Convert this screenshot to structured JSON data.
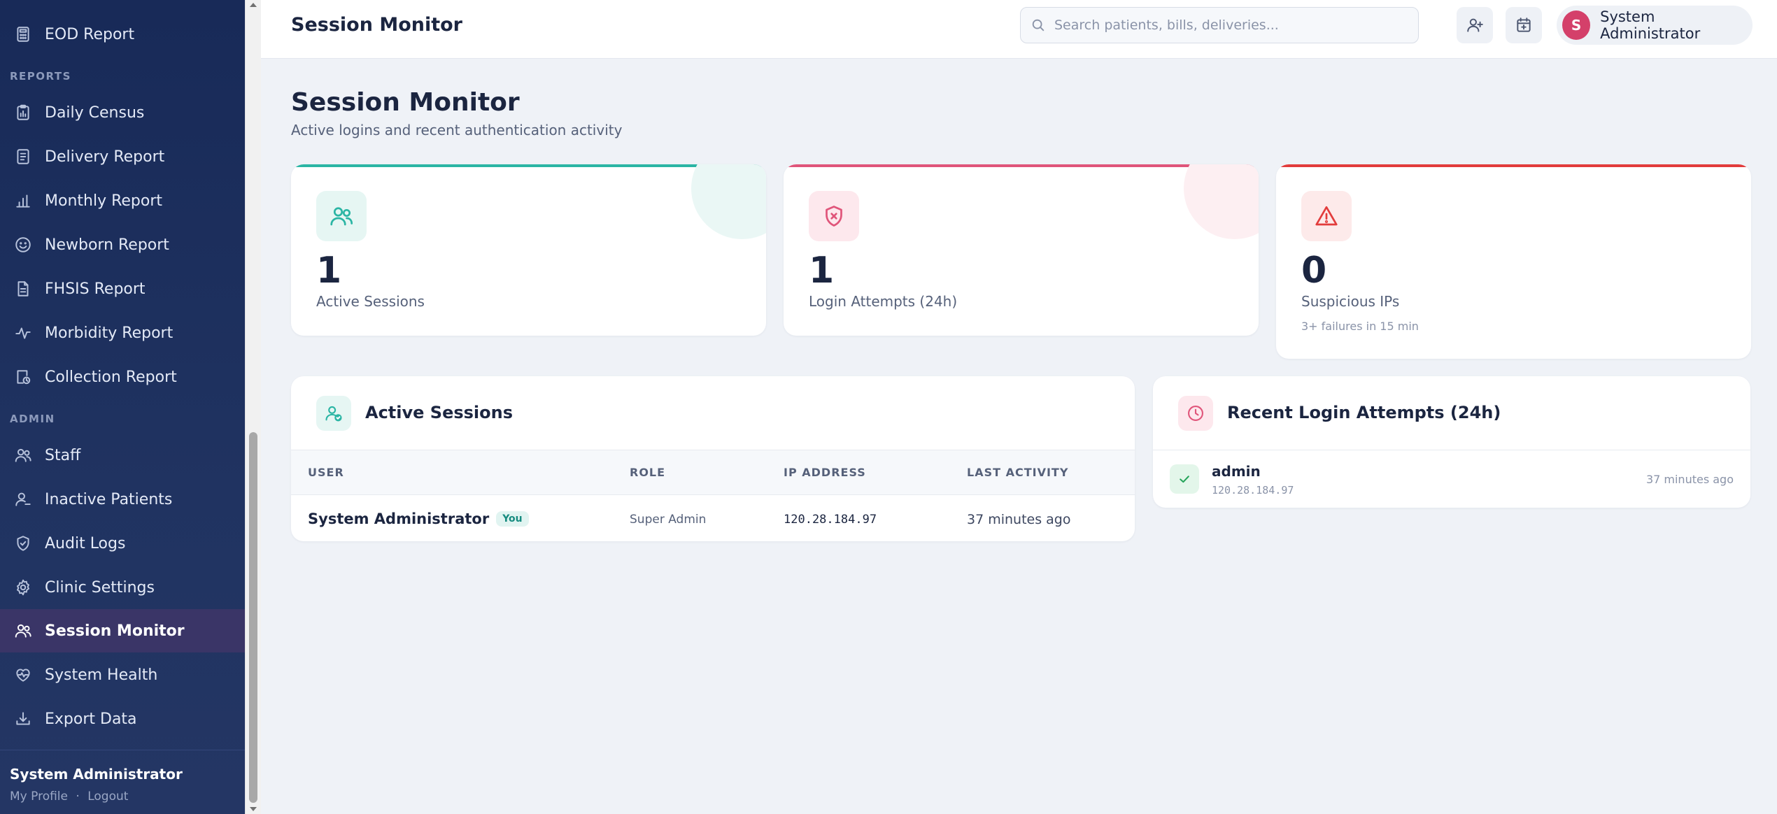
{
  "sidebar": {
    "items_top": [
      {
        "label": "EOD Report",
        "icon": "calculator-icon"
      }
    ],
    "sections": {
      "reports": "REPORTS",
      "admin": "ADMIN"
    },
    "reports": [
      {
        "label": "Daily Census",
        "icon": "clipboard-chart-icon"
      },
      {
        "label": "Delivery Report",
        "icon": "document-icon"
      },
      {
        "label": "Monthly Report",
        "icon": "bar-chart-icon"
      },
      {
        "label": "Newborn Report",
        "icon": "smile-icon"
      },
      {
        "label": "FHSIS Report",
        "icon": "file-text-icon"
      },
      {
        "label": "Morbidity Report",
        "icon": "activity-icon"
      },
      {
        "label": "Collection Report",
        "icon": "receipt-clock-icon"
      }
    ],
    "admin": [
      {
        "label": "Staff",
        "icon": "users-icon"
      },
      {
        "label": "Inactive Patients",
        "icon": "user-minus-icon"
      },
      {
        "label": "Audit Logs",
        "icon": "shield-check-icon"
      },
      {
        "label": "Clinic Settings",
        "icon": "gear-icon"
      },
      {
        "label": "Session Monitor",
        "icon": "users-icon",
        "active": true
      },
      {
        "label": "System Health",
        "icon": "heart-pulse-icon"
      },
      {
        "label": "Export Data",
        "icon": "download-icon"
      }
    ],
    "footer": {
      "name": "System Administrator",
      "profile_link": "My Profile",
      "separator": "·",
      "logout_link": "Logout"
    }
  },
  "header": {
    "title": "Session Monitor",
    "search_placeholder": "Search patients, bills, deliveries...",
    "user_initial": "S",
    "user_name": "System Administrator"
  },
  "page": {
    "title": "Session Monitor",
    "subtitle": "Active logins and recent authentication activity"
  },
  "stats": [
    {
      "value": "1",
      "label": "Active Sessions",
      "accent": "#2bb5a4",
      "icon": "users-icon"
    },
    {
      "value": "1",
      "label": "Login Attempts (24h)",
      "accent": "#e0557a",
      "icon": "shield-x-icon"
    },
    {
      "value": "0",
      "label": "Suspicious IPs",
      "note": "3+ failures in 15 min",
      "accent": "#e23c3c",
      "icon": "alert-triangle-icon"
    }
  ],
  "active_sessions": {
    "title": "Active Sessions",
    "columns": [
      "USER",
      "ROLE",
      "IP ADDRESS",
      "LAST ACTIVITY"
    ],
    "rows": [
      {
        "user": "System Administrator",
        "badge": "You",
        "role": "Super Admin",
        "ip": "120.28.184.97",
        "last_activity": "37 minutes ago"
      }
    ]
  },
  "recent_attempts": {
    "title": "Recent Login Attempts (24h)",
    "items": [
      {
        "username": "admin",
        "ip": "120.28.184.97",
        "time": "37 minutes ago",
        "status": "success"
      }
    ]
  }
}
